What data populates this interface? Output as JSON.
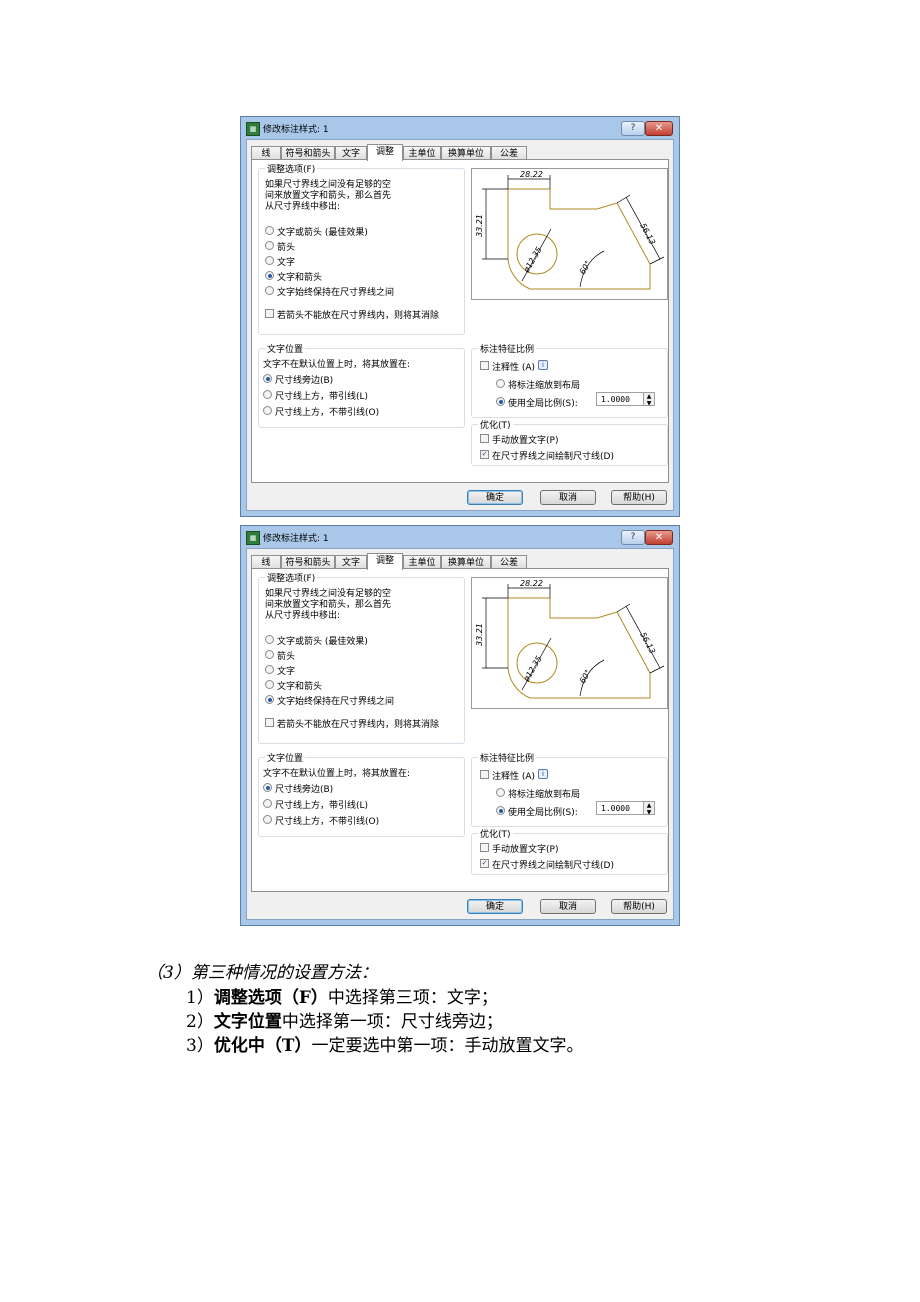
{
  "dialogs": [
    {
      "title": "修改标注样式: 1",
      "tabs": [
        "线",
        "符号和箭头",
        "文字",
        "调整",
        "主单位",
        "换算单位",
        "公差"
      ],
      "active_tab": "调整",
      "fit": {
        "label": "调整选项(F)",
        "description": [
          "如果尺寸界线之间没有足够的空",
          "间来放置文字和箭头，那么首先",
          "从尺寸界线中移出:"
        ],
        "options": [
          "文字或箭头 (最佳效果)",
          "箭头",
          "文字",
          "文字和箭头",
          "文字始终保持在尺寸界线之间"
        ],
        "selected_index": 3,
        "suppress_label": "若箭头不能放在尺寸界线内，则将其消除",
        "suppress_checked": false
      },
      "text_placement": {
        "label": "文字位置",
        "description": "文字不在默认位置上时，将其放置在:",
        "options": [
          "尺寸线旁边(B)",
          "尺寸线上方，带引线(L)",
          "尺寸线上方，不带引线(O)"
        ],
        "selected_index": 0
      },
      "scale": {
        "label": "标注特征比例",
        "annotative_label": "注释性 (A)",
        "annotative_checked": false,
        "info_icon": "i",
        "layout_option": "将标注缩放到布局",
        "global_option": "使用全局比例(S):",
        "global_selected": true,
        "value": "1.0000"
      },
      "finetune": {
        "label": "优化(T)",
        "manual_label": "手动放置文字(P)",
        "manual_checked": false,
        "draw_label": "在尺寸界线之间绘制尺寸线(D)",
        "draw_checked": true
      },
      "preview": {
        "dim_top": "28.22",
        "dim_left": "33.21",
        "dim_right": "56.13",
        "dim_dia": "ø12.35",
        "dim_angle": "60°"
      },
      "buttons": {
        "ok": "确定",
        "cancel": "取消",
        "help": "帮助(H)"
      },
      "close_icon": "close-icon",
      "help_icon": "?"
    },
    {
      "title": "修改标注样式: 1",
      "tabs": [
        "线",
        "符号和箭头",
        "文字",
        "调整",
        "主单位",
        "换算单位",
        "公差"
      ],
      "active_tab": "调整",
      "fit": {
        "label": "调整选项(F)",
        "description": [
          "如果尺寸界线之间没有足够的空",
          "间来放置文字和箭头，那么首先",
          "从尺寸界线中移出:"
        ],
        "options": [
          "文字或箭头 (最佳效果)",
          "箭头",
          "文字",
          "文字和箭头",
          "文字始终保持在尺寸界线之间"
        ],
        "selected_index": 4,
        "suppress_label": "若箭头不能放在尺寸界线内，则将其消除",
        "suppress_checked": false
      },
      "text_placement": {
        "label": "文字位置",
        "description": "文字不在默认位置上时，将其放置在:",
        "options": [
          "尺寸线旁边(B)",
          "尺寸线上方，带引线(L)",
          "尺寸线上方，不带引线(O)"
        ],
        "selected_index": 0
      },
      "scale": {
        "label": "标注特征比例",
        "annotative_label": "注释性 (A)",
        "annotative_checked": false,
        "info_icon": "i",
        "layout_option": "将标注缩放到布局",
        "global_option": "使用全局比例(S):",
        "global_selected": true,
        "value": "1.0000"
      },
      "finetune": {
        "label": "优化(T)",
        "manual_label": "手动放置文字(P)",
        "manual_checked": false,
        "draw_label": "在尺寸界线之间绘制尺寸线(D)",
        "draw_checked": true
      },
      "preview": {
        "dim_top": "28.22",
        "dim_left": "33.21",
        "dim_right": "56.13",
        "dim_dia": "ø12.35",
        "dim_angle": "60°"
      },
      "buttons": {
        "ok": "确定",
        "cancel": "取消",
        "help": "帮助(H)"
      },
      "close_icon": "close-icon",
      "help_icon": "?"
    }
  ],
  "caption": {
    "heading": "（3）第三种情况的设置方法：",
    "steps": [
      {
        "num": "1）",
        "bold": "调整选项（F）",
        "rest": "中选择第三项：文字；"
      },
      {
        "num": "2）",
        "bold": "文字位置",
        "rest": "中选择第一项：尺寸线旁边；"
      },
      {
        "num": "3）",
        "bold": "优化中（T）",
        "rest": "一定要选中第一项：手动放置文字。"
      }
    ]
  }
}
